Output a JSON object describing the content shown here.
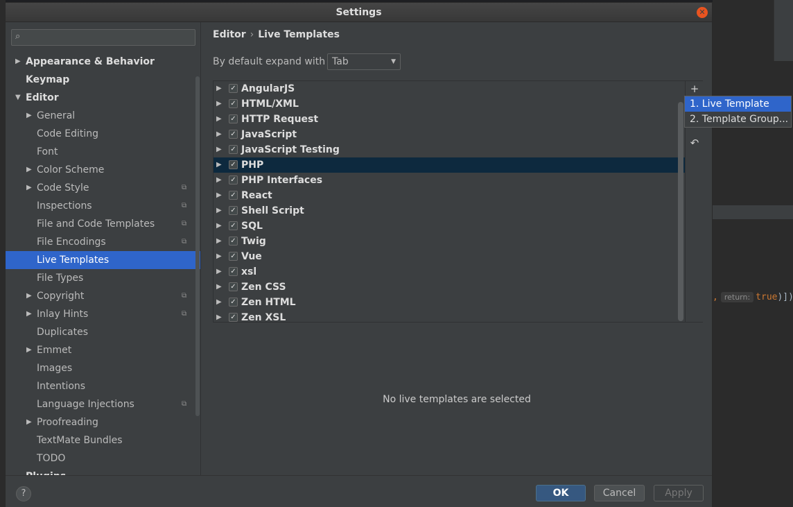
{
  "window": {
    "title": "Settings"
  },
  "sidebar": {
    "search_placeholder": "",
    "items": [
      {
        "label": "Appearance & Behavior",
        "level": 0,
        "expandable": true,
        "expanded": false,
        "bold": true,
        "project": false,
        "selected": false
      },
      {
        "label": "Keymap",
        "level": 0,
        "expandable": false,
        "bold": true,
        "project": false,
        "selected": false
      },
      {
        "label": "Editor",
        "level": 0,
        "expandable": true,
        "expanded": true,
        "bold": true,
        "project": false,
        "selected": false
      },
      {
        "label": "General",
        "level": 1,
        "expandable": true,
        "expanded": false,
        "project": false,
        "selected": false
      },
      {
        "label": "Code Editing",
        "level": 1,
        "expandable": false,
        "project": false,
        "selected": false
      },
      {
        "label": "Font",
        "level": 1,
        "expandable": false,
        "project": false,
        "selected": false
      },
      {
        "label": "Color Scheme",
        "level": 1,
        "expandable": true,
        "expanded": false,
        "project": false,
        "selected": false
      },
      {
        "label": "Code Style",
        "level": 1,
        "expandable": true,
        "expanded": false,
        "project": true,
        "selected": false
      },
      {
        "label": "Inspections",
        "level": 1,
        "expandable": false,
        "project": true,
        "selected": false
      },
      {
        "label": "File and Code Templates",
        "level": 1,
        "expandable": false,
        "project": true,
        "selected": false
      },
      {
        "label": "File Encodings",
        "level": 1,
        "expandable": false,
        "project": true,
        "selected": false
      },
      {
        "label": "Live Templates",
        "level": 1,
        "expandable": false,
        "project": false,
        "selected": true
      },
      {
        "label": "File Types",
        "level": 1,
        "expandable": false,
        "project": false,
        "selected": false
      },
      {
        "label": "Copyright",
        "level": 1,
        "expandable": true,
        "expanded": false,
        "project": true,
        "selected": false
      },
      {
        "label": "Inlay Hints",
        "level": 1,
        "expandable": true,
        "expanded": false,
        "project": true,
        "selected": false
      },
      {
        "label": "Duplicates",
        "level": 1,
        "expandable": false,
        "project": false,
        "selected": false
      },
      {
        "label": "Emmet",
        "level": 1,
        "expandable": true,
        "expanded": false,
        "project": false,
        "selected": false
      },
      {
        "label": "Images",
        "level": 1,
        "expandable": false,
        "project": false,
        "selected": false
      },
      {
        "label": "Intentions",
        "level": 1,
        "expandable": false,
        "project": false,
        "selected": false
      },
      {
        "label": "Language Injections",
        "level": 1,
        "expandable": false,
        "project": true,
        "selected": false
      },
      {
        "label": "Proofreading",
        "level": 1,
        "expandable": true,
        "expanded": false,
        "project": false,
        "selected": false
      },
      {
        "label": "TextMate Bundles",
        "level": 1,
        "expandable": false,
        "project": false,
        "selected": false
      },
      {
        "label": "TODO",
        "level": 1,
        "expandable": false,
        "project": false,
        "selected": false
      },
      {
        "label": "Plugins",
        "level": 0,
        "expandable": false,
        "bold": true,
        "project": false,
        "selected": false
      }
    ]
  },
  "main": {
    "breadcrumb": {
      "parent": "Editor",
      "separator": "›",
      "current": "Live Templates"
    },
    "expand": {
      "label": "By default expand with",
      "value": "Tab"
    },
    "groups": [
      {
        "name": "AngularJS",
        "checked": true,
        "selected": false
      },
      {
        "name": "HTML/XML",
        "checked": true,
        "selected": false
      },
      {
        "name": "HTTP Request",
        "checked": true,
        "selected": false
      },
      {
        "name": "JavaScript",
        "checked": true,
        "selected": false
      },
      {
        "name": "JavaScript Testing",
        "checked": true,
        "selected": false
      },
      {
        "name": "PHP",
        "checked": true,
        "selected": true
      },
      {
        "name": "PHP Interfaces",
        "checked": true,
        "selected": false
      },
      {
        "name": "React",
        "checked": true,
        "selected": false
      },
      {
        "name": "Shell Script",
        "checked": true,
        "selected": false
      },
      {
        "name": "SQL",
        "checked": true,
        "selected": false
      },
      {
        "name": "Twig",
        "checked": true,
        "selected": false
      },
      {
        "name": "Vue",
        "checked": true,
        "selected": false
      },
      {
        "name": "xsl",
        "checked": true,
        "selected": false
      },
      {
        "name": "Zen CSS",
        "checked": true,
        "selected": false
      },
      {
        "name": "Zen HTML",
        "checked": true,
        "selected": false
      },
      {
        "name": "Zen XSL",
        "checked": true,
        "selected": false
      }
    ],
    "add_popup": {
      "items": [
        "1. Live Template",
        "2. Template Group..."
      ]
    },
    "empty_message": "No live templates are selected"
  },
  "footer": {
    "ok": "OK",
    "cancel": "Cancel",
    "apply": "Apply",
    "help": "?"
  },
  "background_code": {
    "comma": ",",
    "hint": "return:",
    "value": "true",
    "close": ")])"
  },
  "icons": {
    "add": "plus-icon",
    "restore": "undo-icon",
    "close": "close-icon",
    "search": "search-icon",
    "help": "help-icon",
    "project_scope": "project-scope-icon"
  },
  "colors": {
    "accent": "#2f65ca",
    "selected_row": "#0d293e",
    "ok_button": "#365880",
    "close_button": "#e95420"
  }
}
